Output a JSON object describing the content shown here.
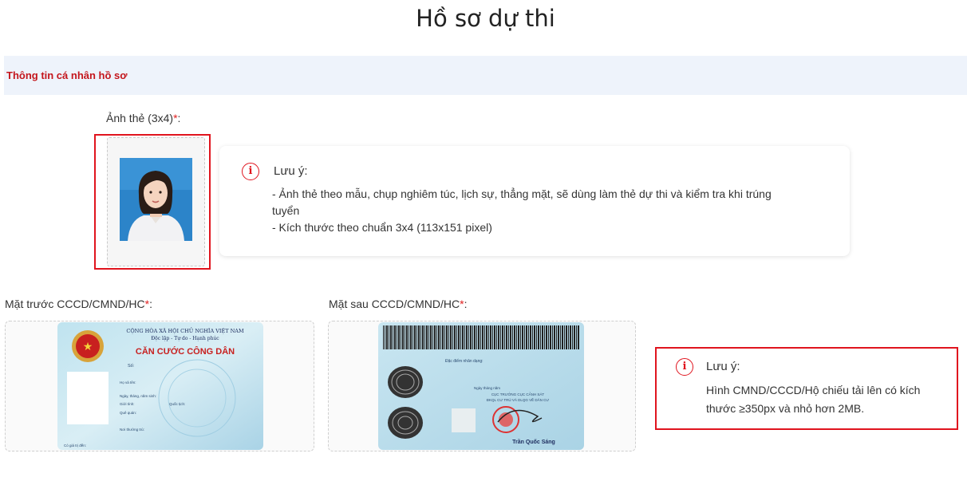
{
  "page": {
    "title": "Hồ sơ dự thi"
  },
  "section": {
    "title": "Thông tin cá nhân hồ sơ"
  },
  "photo": {
    "label": "Ảnh thẻ (3x4)",
    "required_mark": "*",
    "colon": ":"
  },
  "photo_note": {
    "icon": "info-icon",
    "title": "Lưu ý:",
    "line1": "- Ảnh thẻ theo mẫu, chụp nghiêm túc, lịch sự, thẳng mặt, sẽ dùng làm thẻ dự thi và kiểm tra khi trúng",
    "line1b": "tuyển",
    "line2": "- Kích thước theo chuẩn 3x4 (113x151 pixel)"
  },
  "id_front": {
    "label": "Mặt trước CCCD/CMND/HC",
    "required_mark": "*",
    "colon": ":",
    "card": {
      "header1": "CỘNG HÒA XÃ HỘI CHỦ NGHĨA VIỆT NAM",
      "header2": "Độc lập - Tự do - Hạnh phúc",
      "title": "CĂN CƯỚC CÔNG DÂN",
      "f_number": "Số:",
      "f_name": "Họ và tên:",
      "f_dob": "Ngày, tháng, năm sinh:",
      "f_sex": "Giới tính:",
      "f_nat": "Quốc tịch:",
      "f_home": "Quê quán:",
      "f_res": "Nơi thường trú:",
      "f_exp": "Có giá trị đến:"
    }
  },
  "id_back": {
    "label": "Mặt sau CCCD/CMND/HC",
    "required_mark": "*",
    "colon": ":",
    "card": {
      "features": "Đặc điểm nhân dạng:",
      "date": "Ngày      tháng      năm",
      "office1": "CỤC TRƯỞNG CỤC CẢNH SÁT",
      "office2": "ĐKQL CƯ TRÚ VÀ DLQG VỀ DÂN CƯ",
      "signer": "Trần Quốc Sáng"
    }
  },
  "id_note": {
    "icon": "info-icon",
    "title": "Lưu ý:",
    "line1": "Hình CMND/CCCD/Hộ chiếu tải lên có kích",
    "line2": "thước ≥350px và nhỏ hơn 2MB."
  },
  "colors": {
    "accent": "#e0141e",
    "section_bg": "#eef3fb",
    "section_text": "#c4161c"
  }
}
